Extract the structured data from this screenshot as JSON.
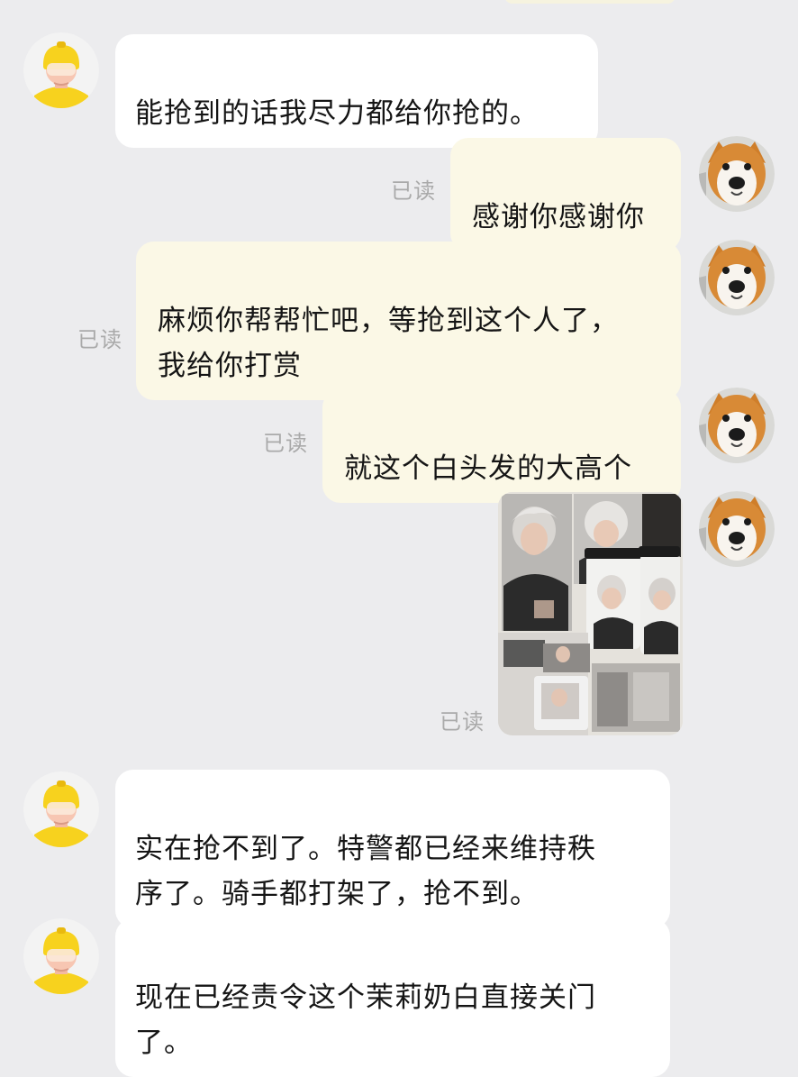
{
  "messages": [
    {
      "id": "m1",
      "side": "incoming",
      "text": "能抢到的话我尽力都给你抢的。"
    },
    {
      "id": "m2",
      "side": "outgoing",
      "text": "感谢你感谢你",
      "status": "已读"
    },
    {
      "id": "m3",
      "side": "outgoing",
      "text": "麻烦你帮帮忙吧，等抢到这个人了，\n我给你打赏",
      "status": "已读"
    },
    {
      "id": "m4",
      "side": "outgoing",
      "text": "就这个白头发的大高个",
      "status": "已读"
    },
    {
      "id": "m5",
      "side": "outgoing",
      "type": "image",
      "image_desc": "merch-photo",
      "status": "已读"
    },
    {
      "id": "m6",
      "side": "incoming",
      "text": "实在抢不到了。特警都已经来维持秩\n序了。骑手都打架了，抢不到。"
    },
    {
      "id": "m7",
      "side": "incoming",
      "text": "现在已经责令这个茉莉奶白直接关门\n了。"
    }
  ],
  "colors": {
    "background": "#ececee",
    "incoming_bubble": "#ffffff",
    "outgoing_bubble": "#fbf8e6",
    "read_status": "#aaaaaa",
    "incoming_avatar_accent": "#f7d21e"
  },
  "icons": {
    "incoming_avatar": "yellow-helmet-avatar-icon",
    "outgoing_avatar": "shiba-dog-avatar-icon"
  }
}
